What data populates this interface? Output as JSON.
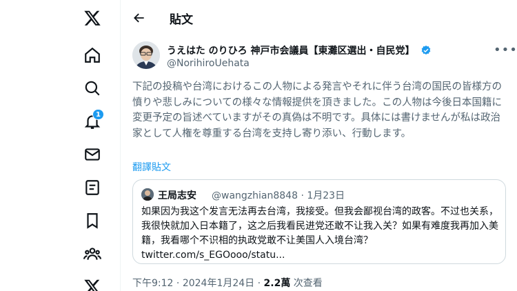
{
  "nav": {
    "notification_count": "1"
  },
  "header": {
    "title": "貼文"
  },
  "tweet": {
    "display_name": "うえはた のりひろ 神戸市会議員【東灘区選出・自民党】",
    "handle": "@NorihiroUehata",
    "text": "下記の投稿や台湾におけるこの人物による発言やそれに伴う台湾の国民の皆様方の憤りや悲しみについての様々な情報提供を頂きました。この人物は今後日本国籍に変更予定の旨述べていますがその真偽は不明です。具体には書けませんが私は政治家として人権を尊重する台湾を支持し寄り添い、行動します。",
    "translate_label": "翻譯貼文",
    "time": "下午9:12",
    "date": "2024年1月24日",
    "views": "2.2萬",
    "views_label": "次查看",
    "separator": "·"
  },
  "quote": {
    "name": "王局志安",
    "handle": "@wangzhian8848",
    "date": "1月23日",
    "text": "如果因为我这个发言无法再去台湾，我接受。但我会鄙视台湾的政客。不过也关系，我很快就加入日本籍了，这之后我看民进党还敢不让我入关？如果有难度我再加入美籍，我看哪个不识相的执政党敢不让美国人入境台湾？",
    "link": "twitter.com/s_EGOooo/statu..."
  },
  "colors": {
    "accent": "#1d9bf0",
    "text": "#0f1419",
    "secondary": "#536471",
    "verified": "#1d9bf0"
  },
  "icons": [
    "x-logo-icon",
    "home-icon",
    "search-icon",
    "bell-icon",
    "mail-icon",
    "list-icon",
    "bookmark-icon",
    "communities-icon",
    "x-premium-icon",
    "back-arrow-icon",
    "verified-icon",
    "more-icon"
  ]
}
